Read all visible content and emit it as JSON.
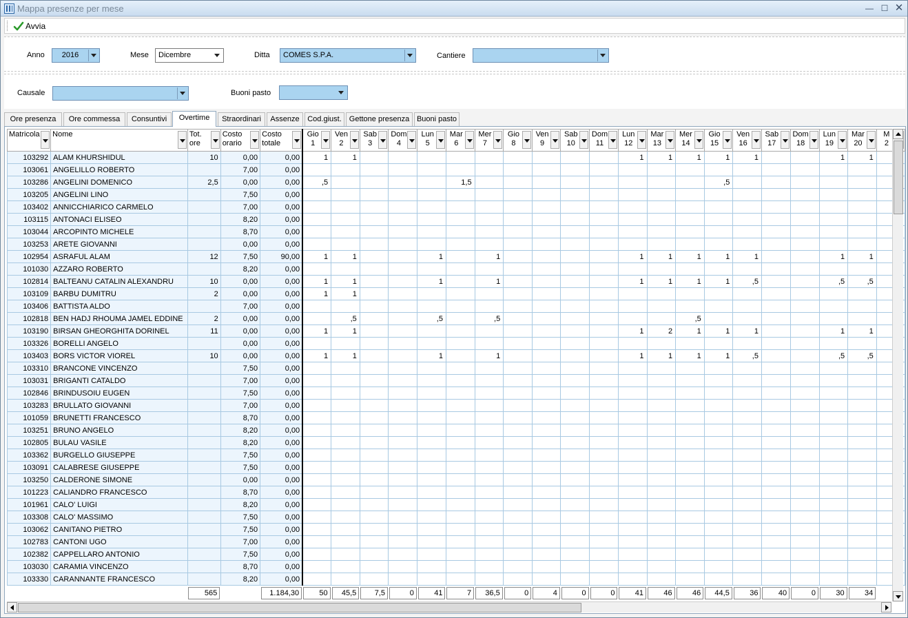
{
  "window": {
    "title": "Mappa presenze per mese"
  },
  "toolbar": {
    "run_label": "Avvia"
  },
  "filters": {
    "anno_label": "Anno",
    "anno_value": "2016",
    "mese_label": "Mese",
    "mese_value": "Dicembre",
    "ditta_label": "Ditta",
    "ditta_value": "COMES S.P.A.",
    "cantiere_label": "Cantiere",
    "cantiere_value": "",
    "causale_label": "Causale",
    "causale_value": "",
    "buoni_label": "Buoni pasto",
    "buoni_value": ""
  },
  "tabs": [
    "Ore presenza",
    "Ore commessa",
    "Consuntivi",
    "Overtime",
    "Straordinari",
    "Assenze",
    "Cod.giust.",
    "Gettone presenza",
    "Buoni pasto"
  ],
  "active_tab": "Overtime",
  "grid": {
    "columns": {
      "matricola": "Matricola",
      "nome": "Nome",
      "tot_ore": [
        "Tot.",
        "ore"
      ],
      "costo_orario": [
        "Costo",
        "orario"
      ],
      "costo_totale": [
        "Costo",
        "totale"
      ]
    },
    "days": [
      [
        "Gio",
        "1"
      ],
      [
        "Ven",
        "2"
      ],
      [
        "Sab",
        "3"
      ],
      [
        "Dom",
        "4"
      ],
      [
        "Lun",
        "5"
      ],
      [
        "Mar",
        "6"
      ],
      [
        "Mer",
        "7"
      ],
      [
        "Gio",
        "8"
      ],
      [
        "Ven",
        "9"
      ],
      [
        "Sab",
        "10"
      ],
      [
        "Dom",
        "11"
      ],
      [
        "Lun",
        "12"
      ],
      [
        "Mar",
        "13"
      ],
      [
        "Mer",
        "14"
      ],
      [
        "Gio",
        "15"
      ],
      [
        "Ven",
        "16"
      ],
      [
        "Sab",
        "17"
      ],
      [
        "Dom",
        "18"
      ],
      [
        "Lun",
        "19"
      ],
      [
        "Mar",
        "20"
      ],
      [
        "M",
        "2"
      ]
    ],
    "rows": [
      {
        "m": "103292",
        "n": "ALAM KHURSHIDUL",
        "t": "10",
        "co": "0,00",
        "ct": "0,00",
        "d": [
          "1",
          "1",
          "",
          "",
          "",
          "",
          "",
          "",
          "",
          "",
          "",
          "1",
          "1",
          "1",
          "1",
          "1",
          "",
          "",
          "1",
          "1",
          ""
        ]
      },
      {
        "m": "103061",
        "n": "ANGELILLO ROBERTO",
        "t": "",
        "co": "7,00",
        "ct": "0,00",
        "d": []
      },
      {
        "m": "103286",
        "n": "ANGELINI DOMENICO",
        "t": "2,5",
        "co": "0,00",
        "ct": "0,00",
        "d": [
          ",5",
          "",
          "",
          "",
          "",
          "1,5",
          "",
          "",
          "",
          "",
          "",
          "",
          "",
          "",
          ",5",
          "",
          "",
          "",
          "",
          "",
          ""
        ]
      },
      {
        "m": "103205",
        "n": "ANGELINI LINO",
        "t": "",
        "co": "7,50",
        "ct": "0,00",
        "d": []
      },
      {
        "m": "103402",
        "n": "ANNICCHIARICO CARMELO",
        "t": "",
        "co": "7,00",
        "ct": "0,00",
        "d": []
      },
      {
        "m": "103115",
        "n": "ANTONACI ELISEO",
        "t": "",
        "co": "8,20",
        "ct": "0,00",
        "d": []
      },
      {
        "m": "103044",
        "n": "ARCOPINTO MICHELE",
        "t": "",
        "co": "8,70",
        "ct": "0,00",
        "d": []
      },
      {
        "m": "103253",
        "n": "ARETE GIOVANNI",
        "t": "",
        "co": "0,00",
        "ct": "0,00",
        "d": []
      },
      {
        "m": "102954",
        "n": "ASRAFUL ALAM",
        "t": "12",
        "co": "7,50",
        "ct": "90,00",
        "d": [
          "1",
          "1",
          "",
          "",
          "1",
          "",
          "1",
          "",
          "",
          "",
          "",
          "1",
          "1",
          "1",
          "1",
          "1",
          "",
          "",
          "1",
          "1",
          ""
        ]
      },
      {
        "m": "101030",
        "n": "AZZARO ROBERTO",
        "t": "",
        "co": "8,20",
        "ct": "0,00",
        "d": []
      },
      {
        "m": "102814",
        "n": "BALTEANU CATALIN ALEXANDRU",
        "t": "10",
        "co": "0,00",
        "ct": "0,00",
        "d": [
          "1",
          "1",
          "",
          "",
          "1",
          "",
          "1",
          "",
          "",
          "",
          "",
          "1",
          "1",
          "1",
          "1",
          ",5",
          "",
          "",
          ",5",
          ",5",
          ""
        ]
      },
      {
        "m": "103109",
        "n": "BARBU DUMITRU",
        "t": "2",
        "co": "0,00",
        "ct": "0,00",
        "d": [
          "1",
          "1",
          "",
          "",
          "",
          "",
          "",
          "",
          "",
          "",
          "",
          "",
          "",
          "",
          "",
          "",
          "",
          "",
          "",
          "",
          ""
        ]
      },
      {
        "m": "103406",
        "n": "BATTISTA ALDO",
        "t": "",
        "co": "7,00",
        "ct": "0,00",
        "d": []
      },
      {
        "m": "102818",
        "n": "BEN HADJ RHOUMA JAMEL EDDINE",
        "t": "2",
        "co": "0,00",
        "ct": "0,00",
        "d": [
          "",
          ",5",
          "",
          "",
          ",5",
          "",
          ",5",
          "",
          "",
          "",
          "",
          "",
          "",
          ",5",
          "",
          "",
          "",
          "",
          "",
          "",
          ""
        ]
      },
      {
        "m": "103190",
        "n": "BIRSAN GHEORGHITA DORINEL",
        "t": "11",
        "co": "0,00",
        "ct": "0,00",
        "d": [
          "1",
          "1",
          "",
          "",
          "",
          "",
          "",
          "",
          "",
          "",
          "",
          "1",
          "2",
          "1",
          "1",
          "1",
          "",
          "",
          "1",
          "1",
          ""
        ]
      },
      {
        "m": "103326",
        "n": "BORELLI ANGELO",
        "t": "",
        "co": "0,00",
        "ct": "0,00",
        "d": []
      },
      {
        "m": "103403",
        "n": "BORS VICTOR VIOREL",
        "t": "10",
        "co": "0,00",
        "ct": "0,00",
        "d": [
          "1",
          "1",
          "",
          "",
          "1",
          "",
          "1",
          "",
          "",
          "",
          "",
          "1",
          "1",
          "1",
          "1",
          ",5",
          "",
          "",
          ",5",
          ",5",
          ""
        ]
      },
      {
        "m": "103310",
        "n": "BRANCONE VINCENZO",
        "t": "",
        "co": "7,50",
        "ct": "0,00",
        "d": []
      },
      {
        "m": "103031",
        "n": "BRIGANTI CATALDO",
        "t": "",
        "co": "7,00",
        "ct": "0,00",
        "d": []
      },
      {
        "m": "102846",
        "n": "BRINDUSOIU EUGEN",
        "t": "",
        "co": "7,50",
        "ct": "0,00",
        "d": []
      },
      {
        "m": "103283",
        "n": "BRULLATO GIOVANNI",
        "t": "",
        "co": "7,00",
        "ct": "0,00",
        "d": []
      },
      {
        "m": "101059",
        "n": "BRUNETTI FRANCESCO",
        "t": "",
        "co": "8,70",
        "ct": "0,00",
        "d": []
      },
      {
        "m": "103251",
        "n": "BRUNO ANGELO",
        "t": "",
        "co": "8,20",
        "ct": "0,00",
        "d": []
      },
      {
        "m": "102805",
        "n": "BULAU VASILE",
        "t": "",
        "co": "8,20",
        "ct": "0,00",
        "d": []
      },
      {
        "m": "103362",
        "n": "BURGELLO GIUSEPPE",
        "t": "",
        "co": "7,50",
        "ct": "0,00",
        "d": []
      },
      {
        "m": "103091",
        "n": "CALABRESE GIUSEPPE",
        "t": "",
        "co": "7,50",
        "ct": "0,00",
        "d": []
      },
      {
        "m": "103250",
        "n": "CALDERONE SIMONE",
        "t": "",
        "co": "0,00",
        "ct": "0,00",
        "d": []
      },
      {
        "m": "101223",
        "n": "CALIANDRO FRANCESCO",
        "t": "",
        "co": "8,70",
        "ct": "0,00",
        "d": []
      },
      {
        "m": "101961",
        "n": "CALO' LUIGI",
        "t": "",
        "co": "8,20",
        "ct": "0,00",
        "d": []
      },
      {
        "m": "103308",
        "n": "CALO' MASSIMO",
        "t": "",
        "co": "7,50",
        "ct": "0,00",
        "d": []
      },
      {
        "m": "103062",
        "n": "CANITANO PIETRO",
        "t": "",
        "co": "7,50",
        "ct": "0,00",
        "d": []
      },
      {
        "m": "102783",
        "n": "CANTONI UGO",
        "t": "",
        "co": "7,00",
        "ct": "0,00",
        "d": []
      },
      {
        "m": "102382",
        "n": "CAPPELLARO ANTONIO",
        "t": "",
        "co": "7,50",
        "ct": "0,00",
        "d": []
      },
      {
        "m": "103030",
        "n": "CARAMIA VINCENZO",
        "t": "",
        "co": "8,70",
        "ct": "0,00",
        "d": []
      },
      {
        "m": "103330",
        "n": "CARANNANTE FRANCESCO",
        "t": "",
        "co": "8,20",
        "ct": "0,00",
        "d": []
      }
    ],
    "totals": {
      "tot_ore": "565",
      "costo_totale": "1.184,30",
      "days": [
        "50",
        "45,5",
        "7,5",
        "0",
        "41",
        "7",
        "36,5",
        "0",
        "4",
        "0",
        "0",
        "41",
        "46",
        "46",
        "44,5",
        "36",
        "40",
        "0",
        "30",
        "34",
        ""
      ]
    }
  }
}
